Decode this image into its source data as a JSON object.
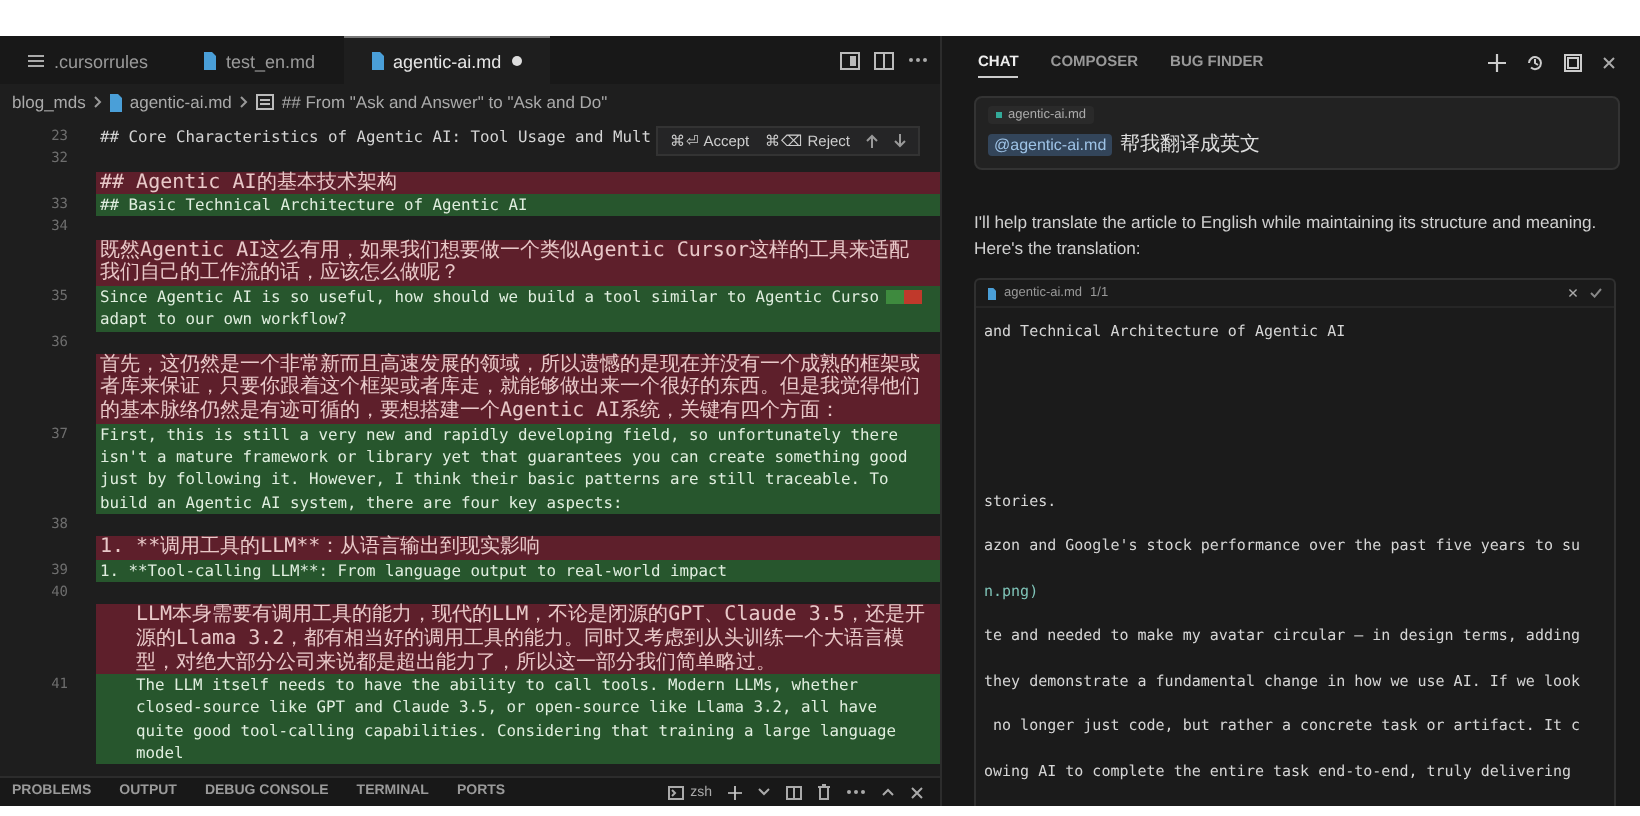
{
  "editor": {
    "tabs": [
      {
        "kind": "config",
        "label": ".cursorrules",
        "selected": false,
        "modified": false
      },
      {
        "kind": "markdown",
        "label": "test_en.md",
        "selected": false,
        "modified": false
      },
      {
        "kind": "markdown",
        "label": "agentic-ai.md",
        "selected": true,
        "modified": true
      }
    ],
    "breadcrumb": [
      "blog_mds",
      "agentic-ai.md",
      "## From \"Ask and Answer\" to \"Ask and Do\""
    ],
    "diff_actions": {
      "accept": "⌘⏎ Accept",
      "reject": "⌘⌫ Reject"
    },
    "rows": [
      {
        "kind": "context",
        "line": "23",
        "text": "## Core Characteristics of Agentic AI: Tool Usage and Mult"
      },
      {
        "kind": "context",
        "line": "32"
      },
      {
        "kind": "removed",
        "text": "## Agentic AI的基本技术架构"
      },
      {
        "kind": "added",
        "line": "33",
        "text": "## Basic Technical Architecture of Agentic AI"
      },
      {
        "kind": "context",
        "line": "34"
      },
      {
        "kind": "removed",
        "text": "既然Agentic AI这么有用，如果我们想要做一个类似Agentic Cursor这样的工具来适配我们自己的工作流的话，应该怎么做呢？"
      },
      {
        "kind": "added",
        "line": "35",
        "text": "Since Agentic AI is so useful, how should we build a tool similar to Agentic Curso",
        "marker": true,
        "text_after": "adapt to our own workflow?"
      },
      {
        "kind": "context",
        "line": "36"
      },
      {
        "kind": "removed",
        "text": "首先，这仍然是一个非常新而且高速发展的领域，所以遗憾的是现在并没有一个成熟的框架或者库来保证，只要你跟着这个框架或者库走，就能够做出来一个很好的东西。但是我觉得他们的基本脉络仍然是有迹可循的，要想搭建一个Agentic AI系统，关键有四个方面："
      },
      {
        "kind": "added",
        "line": "37",
        "text": "First, this is still a very new and rapidly developing field, so unfortunately there isn't a mature framework or library yet that guarantees you can create something good just by following it. However, I think their basic patterns are still traceable. To build an Agentic AI system, there are four key aspects:"
      },
      {
        "kind": "context",
        "line": "38"
      },
      {
        "kind": "removed",
        "text": "1. **调用工具的LLM**：从语言输出到现实影响"
      },
      {
        "kind": "added",
        "line": "39",
        "text": "1. **Tool-calling LLM**: From language output to real-world impact"
      },
      {
        "kind": "context",
        "line": "40"
      },
      {
        "kind": "removed",
        "indented": true,
        "text": "LLM本身需要有调用工具的能力，现代的LLM，不论是闭源的GPT、Claude 3.5，还是开源的Llama 3.2，都有相当好的调用工具的能力。同时又考虑到从头训练一个大语言模型，对绝大部分公司来说都是超出能力了，所以这一部分我们简单略过。"
      },
      {
        "kind": "added",
        "line": "41",
        "indented": true,
        "text": "The LLM itself needs to have the ability to call tools. Modern LLMs, whether closed-source like GPT and Claude 3.5, or open-source like Llama 3.2, all have quite good tool-calling capabilities. Considering that training a large language model"
      }
    ]
  },
  "panel": {
    "tabs": [
      {
        "label": "PROBLEMS",
        "selected": false
      },
      {
        "label": "OUTPUT",
        "selected": false
      },
      {
        "label": "DEBUG CONSOLE",
        "selected": false
      },
      {
        "label": "TERMINAL",
        "selected": false
      },
      {
        "label": "PORTS",
        "selected": false
      }
    ],
    "terminal": "zsh"
  },
  "chat": {
    "tabs": [
      {
        "label": "CHAT",
        "selected": true
      },
      {
        "label": "COMPOSER",
        "selected": false
      },
      {
        "label": "BUG FINDER",
        "selected": false
      }
    ],
    "context_file": "agentic-ai.md",
    "mention": "@agentic-ai.md",
    "message": "帮我翻译成英文",
    "reply": "I'll help translate the article to English while maintaining its structure and meaning. Here's the translation:",
    "code_block": {
      "file": "agentic-ai.md",
      "counter": "1/1",
      "top_lines": [
        {
          "kind": "text",
          "text": "and Technical Architecture of Agentic AI"
        }
      ],
      "bottom_lines": [
        {
          "kind": "text",
          "text": "stories."
        },
        {
          "kind": "text",
          "text": "azon and Google's stock performance over the past five years to su"
        },
        {
          "kind": "link",
          "text": "n.png)"
        },
        {
          "kind": "text",
          "text": "te and needed to make my avatar circular – in design terms, adding"
        },
        {
          "kind": "text",
          "text": "they demonstrate a fundamental change in how we use AI. If we look"
        },
        {
          "kind": "text",
          "text": " no longer just code, but rather a concrete task or artifact. It c"
        },
        {
          "kind": "text",
          "text": "owing AI to complete the entire task end-to-end, truly delivering"
        }
      ]
    }
  }
}
